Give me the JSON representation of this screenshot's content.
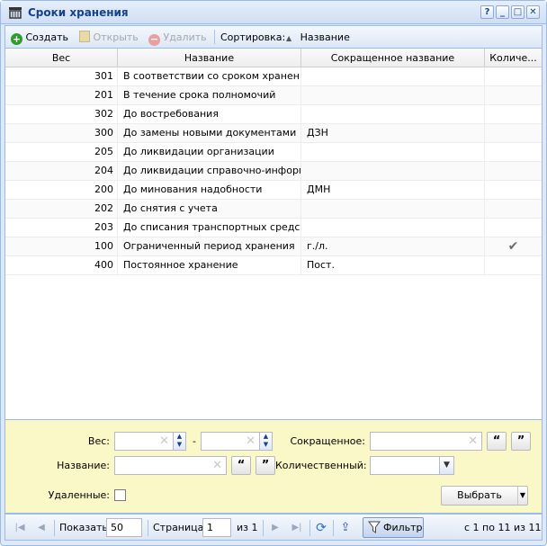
{
  "window": {
    "title": "Сроки хранения",
    "tools": [
      "?",
      "_",
      "□",
      "✕"
    ]
  },
  "toolbar": {
    "create_label": "Создать",
    "open_label": "Открыть",
    "delete_label": "Удалить",
    "sort_label": "Сортировка:",
    "sort_value": "Название"
  },
  "grid": {
    "columns": [
      "Вес",
      "Название",
      "Сокращенное название",
      "Количе..."
    ],
    "rows": [
      {
        "ves": "301",
        "name": "В соответствии со сроком хранения...",
        "short": "",
        "qty": ""
      },
      {
        "ves": "201",
        "name": "В течение срока полномочий",
        "short": "",
        "qty": ""
      },
      {
        "ves": "302",
        "name": "До востребования",
        "short": "",
        "qty": ""
      },
      {
        "ves": "300",
        "name": "До замены новыми документами",
        "short": "ДЗН",
        "qty": ""
      },
      {
        "ves": "205",
        "name": "До ликвидации организации",
        "short": "",
        "qty": ""
      },
      {
        "ves": "204",
        "name": "До ликвидации справочно-информ...",
        "short": "",
        "qty": ""
      },
      {
        "ves": "200",
        "name": "До минования надобности",
        "short": "ДМН",
        "qty": ""
      },
      {
        "ves": "202",
        "name": "До снятия с учета",
        "short": "",
        "qty": ""
      },
      {
        "ves": "203",
        "name": "До списания транспортных средств",
        "short": "",
        "qty": ""
      },
      {
        "ves": "100",
        "name": "Ограниченный период хранения",
        "short": "г./л.",
        "qty": "✔"
      },
      {
        "ves": "400",
        "name": "Постоянное хранение",
        "short": "Пост.",
        "qty": ""
      }
    ]
  },
  "filter": {
    "ves_label": "Вес:",
    "range_dash": "-",
    "name_label": "Название:",
    "short_label": "Сокращенное:",
    "qty_label": "Количественный:",
    "deleted_label": "Удаленные:",
    "select_label": "Выбрать",
    "quote_open": "“",
    "quote_close": "”"
  },
  "pager": {
    "show_label": "Показать",
    "page_size": "50",
    "page_label": "Страница",
    "page_value": "1",
    "of_label": "из 1",
    "filter_label": "Фильтр",
    "summary": "с 1 по 11 из 11"
  },
  "colors": {
    "accent": "#15428b",
    "panel_border": "#99bbe8",
    "filter_bg": "#fbf8c8"
  }
}
